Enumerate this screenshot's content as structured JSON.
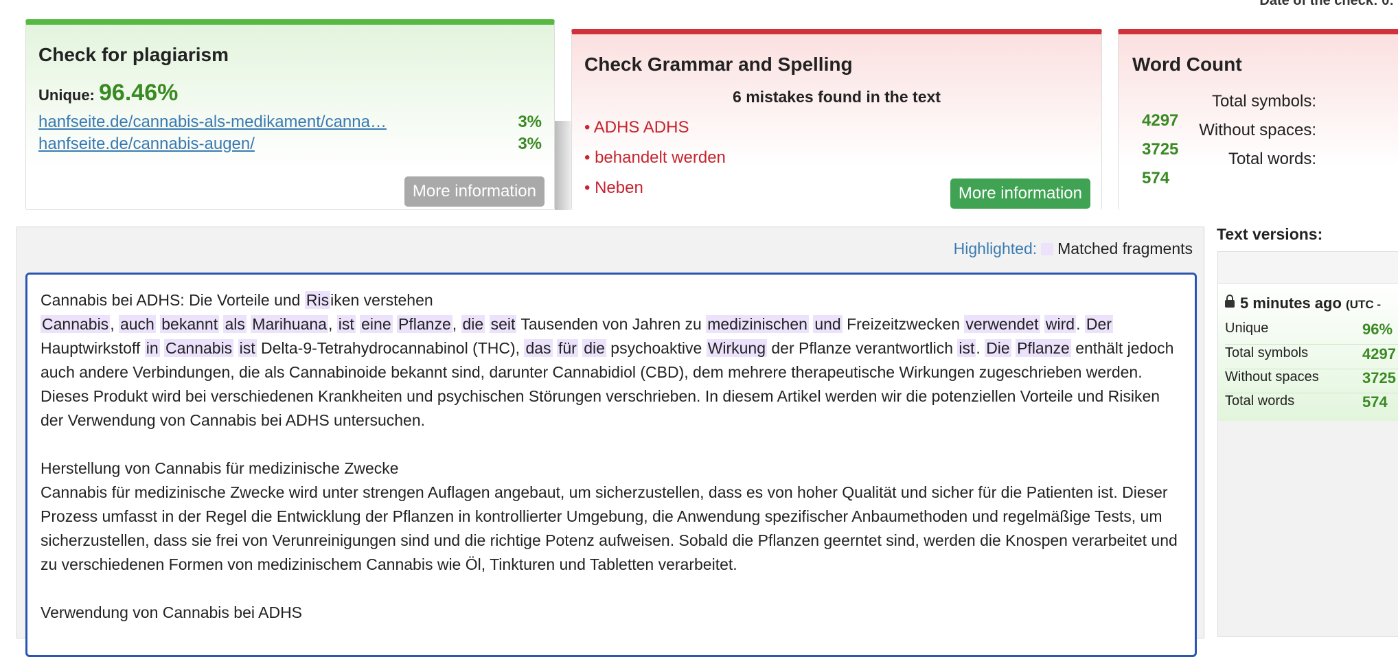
{
  "header": {
    "cut_text": "Date of the check: 0:"
  },
  "plagiarism": {
    "title": "Check for plagiarism",
    "unique_label": "Unique:",
    "unique_value": "96.46%",
    "sources": [
      {
        "url": "hanfseite.de/cannabis-als-medikament/canna…",
        "pct": "3%"
      },
      {
        "url": "hanfseite.de/cannabis-augen/",
        "pct": "3%"
      }
    ],
    "more_button": "More information"
  },
  "grammar": {
    "title": "Check Grammar and Spelling",
    "summary": "6 mistakes found in the text",
    "mistakes": [
      "ADHS ADHS",
      "behandelt werden",
      "Neben"
    ],
    "more_button": "More information"
  },
  "wordcount": {
    "title": "Word Count",
    "rows": [
      {
        "label": "Total symbols:",
        "value": "4297"
      },
      {
        "label": "Without spaces:",
        "value": "3725"
      },
      {
        "label": "Total words:",
        "value": "574"
      }
    ]
  },
  "editor": {
    "highlighted_label": "Highlighted:",
    "legend_label": "Matched fragments",
    "colors": {
      "highlight": "#ece2fb",
      "border": "#2b55b3"
    },
    "h1": "Cannabis bei ADHS: Die Vorteile und Risiken verstehen",
    "h2": "Herstellung von Cannabis für medizinische Zwecke",
    "p2": "Cannabis für medizinische Zwecke wird unter strengen Auflagen angebaut, um sicherzustellen, dass es von hoher Qualität und sicher für die Patienten ist. Dieser Prozess umfasst in der Regel die Entwicklung der Pflanzen in kontrollierter Umgebung, die Anwendung spezifischer Anbaumethoden und regelmäßige Tests, um sicherzustellen, dass sie frei von Verunreinigungen sind und die richtige Potenz aufweisen. Sobald die Pflanzen geerntet sind, werden die Knospen verarbeitet und zu verschiedenen Formen von medizinischem Cannabis wie Öl, Tinkturen und Tabletten verarbeitet.",
    "h3": "Verwendung von Cannabis bei ADHS",
    "p1_tail": "jedoch auch andere Verbindungen, die als Cannabinoide bekannt sind, darunter Cannabidiol (CBD), dem mehrere therapeutische Wirkungen zugeschrieben werden. Dieses Produkt wird bei verschiedenen Krankheiten und psychischen Störungen verschrieben. In diesem Artikel werden wir die potenziellen Vorteile und Risiken der Verwendung von Cannabis bei ADHS untersuchen."
  },
  "versions": {
    "title": "Text versions:",
    "time": "5 minutes ago",
    "tz": "(UTC -",
    "rows": [
      {
        "label": "Unique",
        "value": "96%"
      },
      {
        "label": "Total symbols",
        "value": "4297"
      },
      {
        "label": "Without spaces",
        "value": "3725"
      },
      {
        "label": "Total words",
        "value": "574"
      }
    ]
  }
}
